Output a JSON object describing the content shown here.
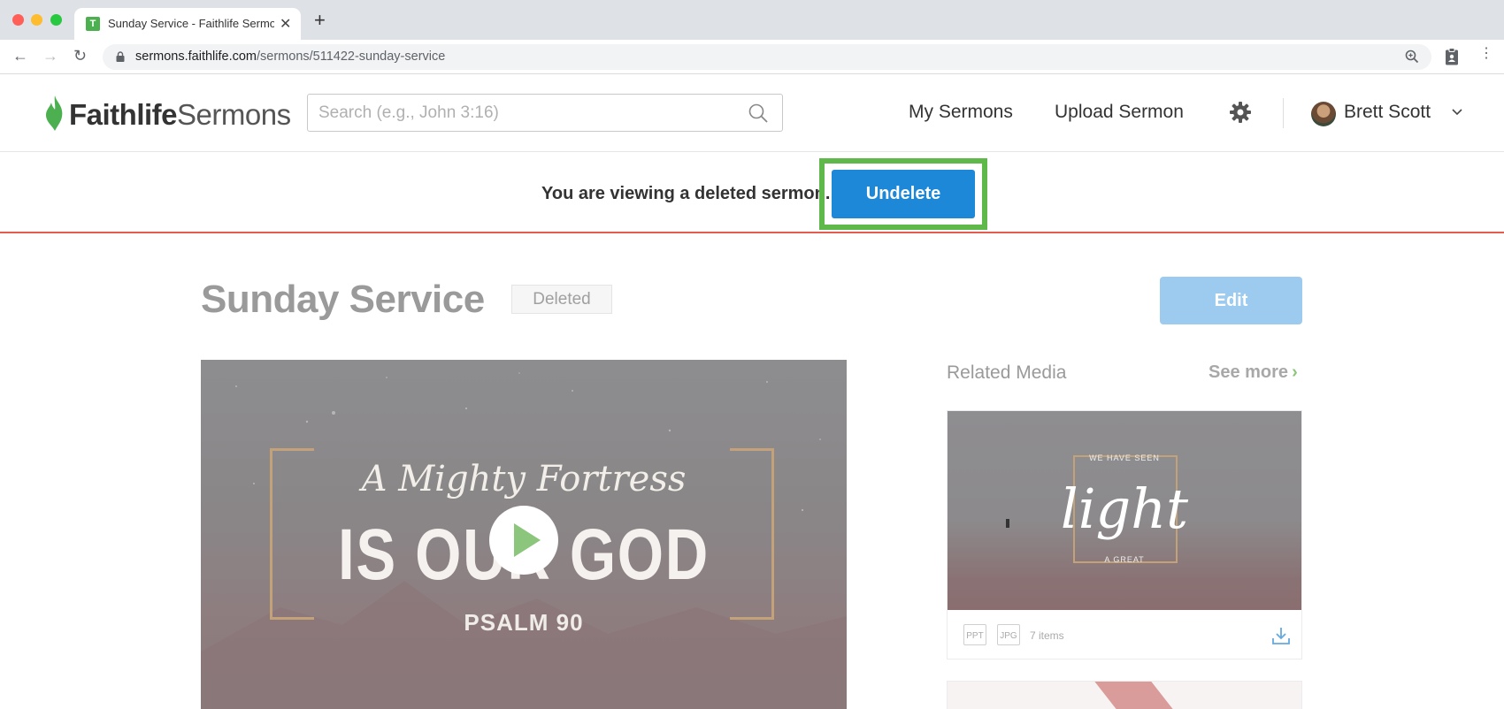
{
  "browser": {
    "tab_title": "Sunday Service - Faithlife Sermons",
    "favicon_glyph": "T",
    "url_host": "sermons.faithlife.com",
    "url_path": "/sermons/511422-sunday-service"
  },
  "header": {
    "logo_bold": "Faithlife",
    "logo_light": "Sermons",
    "search_placeholder": "Search (e.g., John 3:16)",
    "nav_my_sermons": "My Sermons",
    "nav_upload": "Upload Sermon",
    "user_name": "Brett Scott"
  },
  "banner": {
    "message": "You are viewing a deleted sermon.",
    "undelete_label": "Undelete"
  },
  "sermon": {
    "title": "Sunday Service",
    "status_badge": "Deleted",
    "edit_label": "Edit",
    "video_script_line": "A Mighty Fortress",
    "video_main_line": "IS OUR GOD",
    "video_sub_line": "PSALM 90"
  },
  "related": {
    "heading": "Related Media",
    "see_more": "See more",
    "card": {
      "top_line": "WE HAVE SEEN",
      "script_word": "light",
      "bottom_line": "A GREAT",
      "file_types": [
        "PPT",
        "JPG"
      ],
      "items_count": "7 items"
    }
  },
  "colors": {
    "accent_blue": "#1e88d8",
    "highlight_green": "#5fb84a",
    "banner_border_red": "#e25c4f",
    "logo_green": "#4caf50"
  },
  "icons": [
    "lock-icon",
    "zoom-icon",
    "clipboard-icon",
    "kebab-menu-icon",
    "search-icon",
    "gear-icon",
    "chevron-down-icon",
    "play-icon",
    "download-icon"
  ]
}
